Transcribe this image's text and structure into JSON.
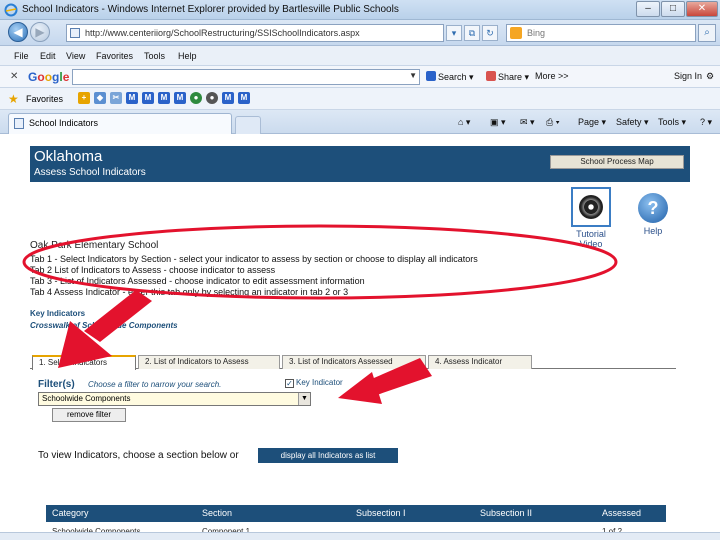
{
  "window": {
    "title": "School Indicators - Windows Internet Explorer provided by Bartlesville Public Schools"
  },
  "address": {
    "url": "http://www.centeriiorg/SchoolRestructuring/SSISchoolIndicators.aspx",
    "search_placeholder": "Bing"
  },
  "menu": {
    "items": [
      "File",
      "Edit",
      "View",
      "Favorites",
      "Tools",
      "Help"
    ]
  },
  "google_toolbar": {
    "logo": "Google",
    "search_label": "Search",
    "share_label": "Share",
    "more_label": "More >>",
    "signin_label": "Sign In"
  },
  "favorites_bar": {
    "label": "Favorites",
    "icons": [
      "add-favorite",
      "suggested-sites",
      "web-slice",
      "m1",
      "m2",
      "m3",
      "m4",
      "globe",
      "m5",
      "m6",
      "m7"
    ]
  },
  "tab": {
    "title": "School Indicators"
  },
  "command_bar": {
    "page_label": "Page",
    "safety_label": "Safety",
    "tools_label": "Tools"
  },
  "page": {
    "state": "Oklahoma",
    "subtitle": "Assess School Indicators",
    "process_map_label": "School Process Map",
    "tutorial_label": "Tutorial Video",
    "help_label": "Help",
    "school_name": "Oak Park Elementary School",
    "tab_lines": [
      "Tab 1 - Select Indicators by Section - select your indicator to assess by section or choose to display all indicators",
      "Tab 2    List of Indicators to Assess - choose indicator to assess",
      "Tab 3 - List of Indicators Assessed - choose indicator to edit assessment information",
      "Tab 4    Assess Indicator - enter this tab only by selecting an indicator in tab 2 or 3"
    ],
    "key_indicators_label": "Key Indicators",
    "crosswalk_label": "Crosswalk of Schoolwide Components",
    "tabs": [
      "1. Select Indicators",
      "2. List of Indicators to Assess",
      "3. List of Indicators Assessed",
      "4. Assess Indicator"
    ],
    "filter_label": "Filter(s)",
    "filter_hint": "Choose a filter to narrow your search.",
    "key_indicator_checkbox": "Key Indicator",
    "filter_value": "Schoolwide Components",
    "remove_filter_label": "remove filter",
    "to_view_text": "To view Indicators, choose a section below or",
    "display_all_label": "display all Indicators as list",
    "table": {
      "headers": [
        "Category",
        "Section",
        "Subsection I",
        "Subsection II",
        "Assessed"
      ],
      "partial_row": [
        "Schoolwide Components",
        "Component 1",
        "",
        "",
        "1 of 2"
      ]
    }
  },
  "annotations": {
    "ellipse_color": "#e3122d",
    "arrow_color": "#e3122d"
  }
}
